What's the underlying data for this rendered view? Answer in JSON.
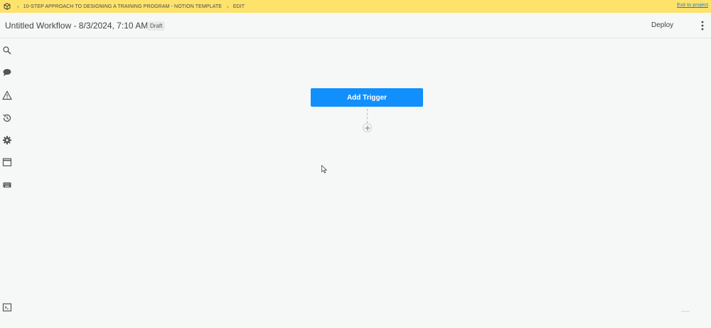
{
  "topbar": {
    "logo_icon": "box-icon",
    "breadcrumb": [
      "10-STEP APPROACH TO DESIGNING A TRAINING PROGRAM - NOTION TEMPLATE",
      "EDIT"
    ],
    "exit_label": "Exit to project",
    "background": "#fde26c",
    "link_color": "#1a7bd8"
  },
  "header": {
    "title": "Untitled Workflow - 8/3/2024, 7:10 AM",
    "status_badge": "Draft",
    "deploy_label": "Deploy",
    "more_icon": "kebab-menu-icon"
  },
  "sidebar": {
    "icons": [
      "search-icon",
      "chat-bubble-icon",
      "warning-icon",
      "history-icon",
      "settings-gear-icon",
      "window-icon",
      "keyboard-icon"
    ],
    "bottom_icon": "terminal-icon"
  },
  "canvas": {
    "trigger_label": "Add Trigger",
    "trigger_color": "#118ffc",
    "add_step_icon": "plus-icon"
  }
}
